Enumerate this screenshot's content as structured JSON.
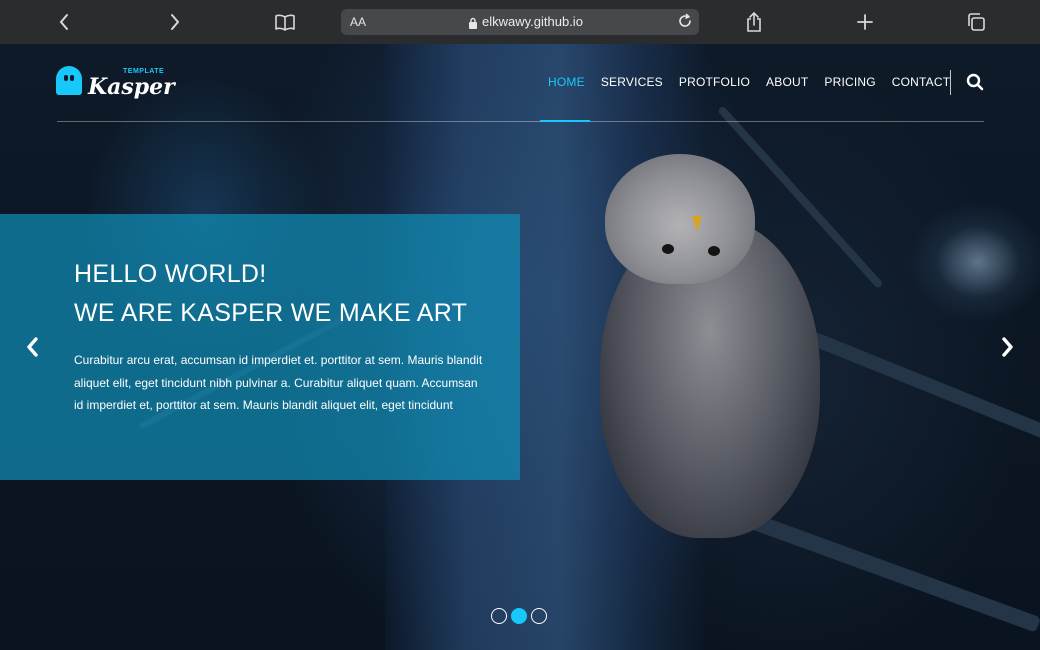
{
  "browser": {
    "reader_label": "AA",
    "host": "elkwawy.github.io",
    "icons": [
      "back-icon",
      "forward-icon",
      "book-icon",
      "lock-icon",
      "reload-icon",
      "share-icon",
      "plus-icon",
      "tabs-icon"
    ]
  },
  "brand": {
    "name": "Kasper",
    "tagline": "TEMPLATE",
    "accent": "#19c8fa"
  },
  "nav": {
    "items": [
      {
        "label": "HOME",
        "active": true
      },
      {
        "label": "SERVICES"
      },
      {
        "label": "PROTFOLIO"
      },
      {
        "label": "ABOUT"
      },
      {
        "label": "PRICING"
      },
      {
        "label": "CONTACT"
      }
    ],
    "search_icon": "search-icon"
  },
  "hero": {
    "heading_line1": "HELLO WORLD!",
    "heading_line2": "WE ARE KASPER WE MAKE ART",
    "body": "Curabitur arcu erat, accumsan id imperdiet et. porttitor at sem. Mauris blandit aliquet elit, eget tincidunt nibh pulvinar a. Curabitur aliquet quam. Accumsan id imperdiet et, porttitor at sem. Mauris blandit aliquet elit, eget tincidunt",
    "overlay_color": "#118cb4",
    "slides": 3,
    "active_slide": 2,
    "prev_icon": "chevron-left-icon",
    "next_icon": "chevron-right-icon"
  }
}
